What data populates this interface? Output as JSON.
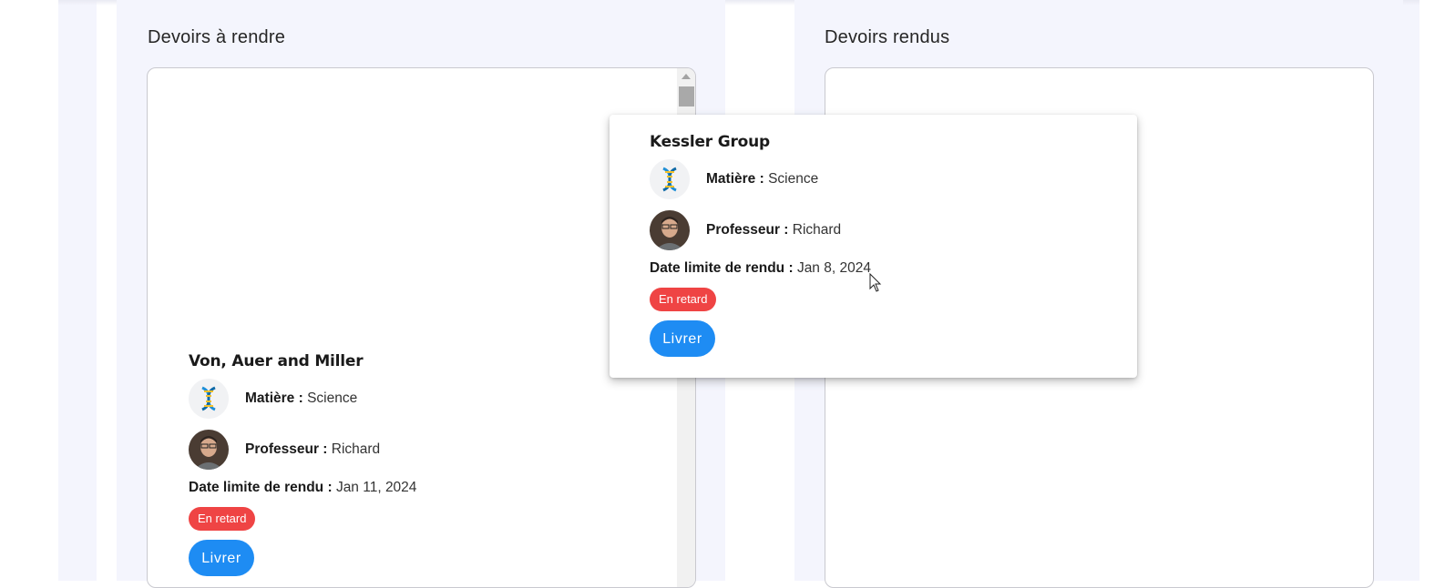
{
  "colors": {
    "page_band": "#f4f5fd",
    "badge_late": "#ef4444",
    "primary_button": "#1e8cf3"
  },
  "pending": {
    "title": "Devoirs à rendre",
    "card": {
      "title": "Von, Auer and Miller",
      "subject_label": "Matière :",
      "subject_value": "Science",
      "subject_icon": "dna-icon",
      "teacher_label": "Professeur :",
      "teacher_value": "Richard",
      "teacher_icon": "teacher-avatar",
      "due_label": "Date limite de rendu :",
      "due_value": "Jan 11, 2024",
      "status": "En retard",
      "button": "Livrer"
    }
  },
  "delivered": {
    "title": "Devoirs rendus"
  },
  "drag_preview": {
    "title": "Kessler Group",
    "subject_label": "Matière :",
    "subject_value": "Science",
    "subject_icon": "dna-icon",
    "teacher_label": "Professeur :",
    "teacher_value": "Richard",
    "teacher_icon": "teacher-avatar",
    "due_label": "Date limite de rendu :",
    "due_value": "Jan 8, 2024",
    "status": "En retard",
    "button": "Livrer"
  }
}
